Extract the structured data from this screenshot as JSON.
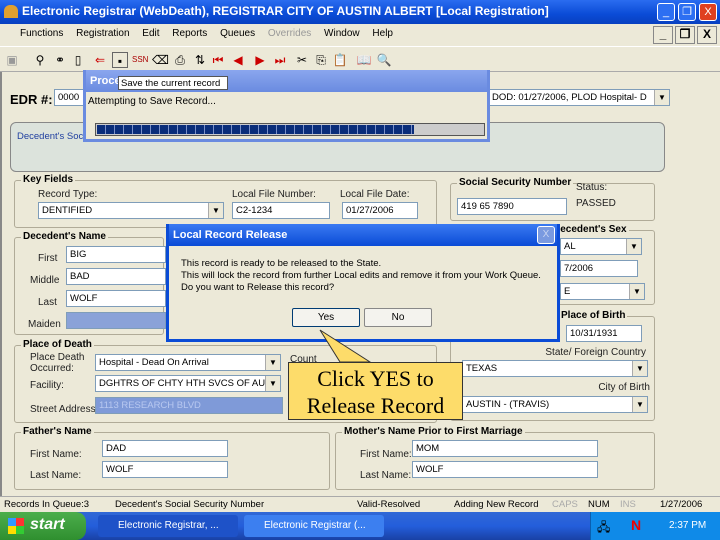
{
  "window": {
    "title": "Electronic Registrar (WebDeath), REGISTRAR   CITY OF AUSTIN   ALBERT   [Local Registration]",
    "minimize": "_",
    "restore": "❐",
    "close": "X"
  },
  "menu": {
    "items": [
      "Functions",
      "Registration",
      "Edit",
      "Reports",
      "Queues",
      "Overrides",
      "Window",
      "Help"
    ],
    "mdi_minimize": "_",
    "mdi_restore": "❐",
    "mdi_close": "X"
  },
  "toolbar": {
    "icons": [
      "window-icon",
      "user-icon",
      "binoculars-icon",
      "new-document-icon",
      "exit-icon",
      "save-icon",
      "ssn-icon",
      "eraser-icon",
      "print-icon",
      "refresh-icon",
      "first-record-icon",
      "previous-record-icon",
      "next-record-icon",
      "last-record-icon",
      "cut-icon",
      "copy-icon",
      "paste-icon",
      "book-icon",
      "search-document-icon"
    ],
    "tooltip": "Save the current record"
  },
  "edr": {
    "label": "EDR #:",
    "value": "0000",
    "dod_text": "DOD:  01/27/2006, PLOD  Hospital- D"
  },
  "ssn_panel": {
    "label": "Decedent's Soc"
  },
  "process_dialog": {
    "title": "Proce",
    "message": "Attempting to Save Record...",
    "progress_percent": 82
  },
  "key_fields": {
    "title": "Key Fields",
    "record_type_label": "Record Type:",
    "record_type": "DENTIFIED",
    "local_file_number_label": "Local File Number:",
    "local_file_number": "C2-1234",
    "local_file_date_label": "Local File Date:",
    "local_file_date": "01/27/2006"
  },
  "ssn": {
    "title": "Social Security Number",
    "value": "419 65 7890",
    "status_label": "Status:",
    "status": "PASSED"
  },
  "sex": {
    "title": "Decedent's Sex",
    "value": "AL",
    "date": "7/2006",
    "third": "E"
  },
  "name": {
    "title": "Decedent's Name",
    "first_label": "First",
    "first": "BIG",
    "middle_label": "Middle",
    "middle": "BAD",
    "last_label": "Last",
    "last": "WOLF",
    "maiden_label": "Maiden"
  },
  "birth": {
    "title": "Place of Birth",
    "date": "10/31/1931",
    "state_label": "State/ Foreign Country",
    "state": "TEXAS",
    "city_label": "City of Birth",
    "city": "AUSTIN - (TRAVIS)"
  },
  "death_place": {
    "title": "Place of Death",
    "occurred_label": "Place Death Occurred:",
    "occurred": "Hospital - Dead On Arrival",
    "county_label": "Count",
    "facility_label": "Facility:",
    "facility": "DGHTRS OF CHTY HTH SVCS OF AUS",
    "street_label": "Street Address:",
    "street": "1113 RESEARCH BLVD"
  },
  "father": {
    "title": "Father's Name",
    "first_label": "First Name:",
    "first": "DAD",
    "last_label": "Last Name:",
    "last": "WOLF"
  },
  "mother": {
    "title": "Mother's Name Prior to First Marriage",
    "first_label": "First Name:",
    "first": "MOM",
    "last_label": "Last Name:",
    "last": "WOLF"
  },
  "release_dialog": {
    "title": "Local Record Release",
    "line1": "This record is ready to be released to the State.",
    "line2": "This will lock the record from further Local edits and remove it from your Work Queue.",
    "line3": "Do you want to Release this record?",
    "yes": "Yes",
    "no": "No",
    "close": "X"
  },
  "callout": {
    "text": "Click YES to Release Record"
  },
  "statusbar": {
    "queue": "Records In Queue:3",
    "field": "Decedent's Social Security Number",
    "validation": "Valid-Resolved",
    "mode": "Adding New Record",
    "caps": "CAPS",
    "num": "NUM",
    "ins": "INS",
    "date": "1/27/2006"
  },
  "taskbar": {
    "start": "start",
    "tasks": [
      "Electronic Registrar, ...",
      "Electronic Registrar (..."
    ],
    "clock": "2:37 PM"
  }
}
